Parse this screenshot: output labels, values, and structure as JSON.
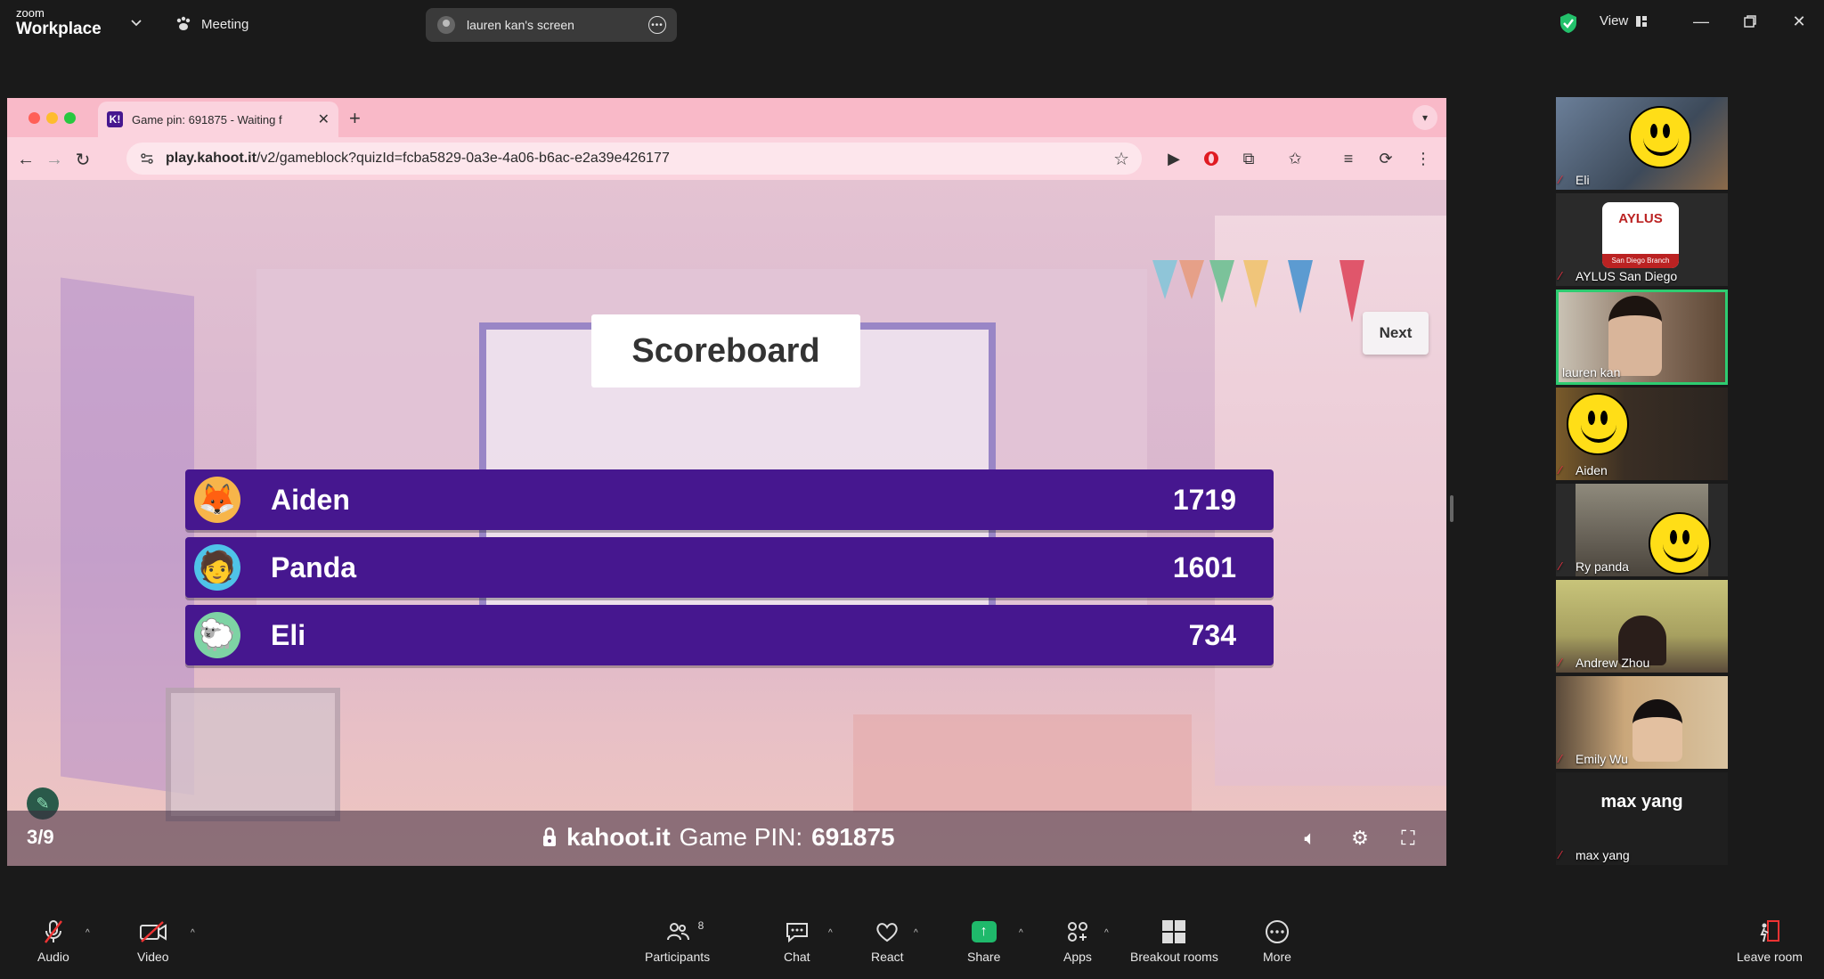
{
  "topbar": {
    "logo_small": "zoom",
    "logo_big": "Workplace",
    "meeting_label": "Meeting",
    "share_pill_label": "lauren kan's screen",
    "view_label": "View"
  },
  "browser": {
    "tab_title": "Game pin: 691875 - Waiting f",
    "tab_favicon": "K!",
    "url_host": "play.kahoot.it",
    "url_path": "/v2/gameblock?quizId=fcba5829-0a3e-4a06-b6ac-e2a39e426177"
  },
  "kahoot": {
    "title": "Scoreboard",
    "next_label": "Next",
    "players": [
      {
        "name": "Aiden",
        "score": "1719",
        "avatar": "🦊",
        "avatar_bg": "#f7b54a"
      },
      {
        "name": "Panda",
        "score": "1601",
        "avatar": "🧑",
        "avatar_bg": "#4fc3e8"
      },
      {
        "name": "Eli",
        "score": "734",
        "avatar": "🐑",
        "avatar_bg": "#7ed3a4"
      }
    ],
    "question_counter": "3/9",
    "footer_site": "kahoot.it",
    "footer_pin_label": "Game PIN:",
    "footer_pin": "691875"
  },
  "participants": [
    {
      "name": "Eli",
      "kind": "smiley-video"
    },
    {
      "name": "AYLUS San Diego",
      "kind": "logo",
      "logo_text": "AYLUS",
      "logo_sub": "San Diego Branch"
    },
    {
      "name": "lauren kan",
      "kind": "video",
      "active": true
    },
    {
      "name": "Aiden",
      "kind": "smiley-video"
    },
    {
      "name": "Ry panda",
      "kind": "smiley-video"
    },
    {
      "name": "Andrew Zhou",
      "kind": "video"
    },
    {
      "name": "Emily Wu",
      "kind": "video"
    },
    {
      "name": "max yang",
      "kind": "name-only",
      "display": "max yang"
    }
  ],
  "toolbar": {
    "audio": "Audio",
    "video": "Video",
    "participants": "Participants",
    "participants_count": "8",
    "chat": "Chat",
    "react": "React",
    "share": "Share",
    "apps": "Apps",
    "breakout": "Breakout rooms",
    "more": "More",
    "leave": "Leave room"
  },
  "colors": {
    "kahoot_purple": "#46178f",
    "share_green": "#1fb96b",
    "active_speaker": "#2ecc71",
    "tab_pink": "#f9b9c8"
  }
}
